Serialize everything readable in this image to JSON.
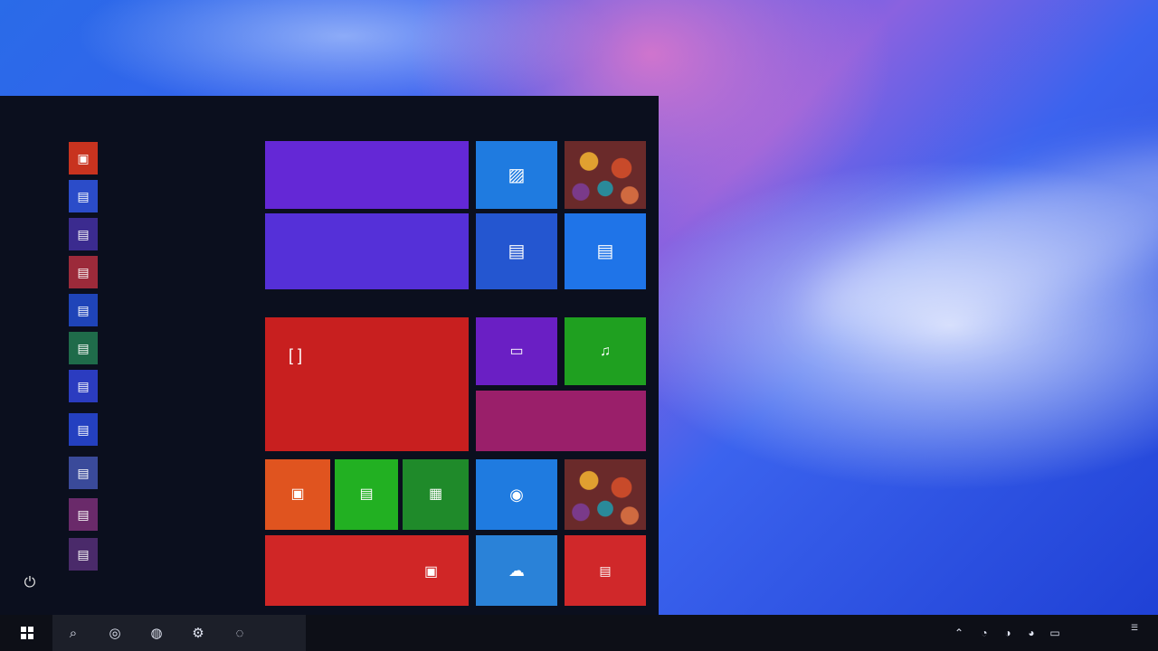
{
  "desktop": {
    "wallpaper": "blue-pink-gradient"
  },
  "start_menu": {
    "apps": [
      {
        "icon": "store-app-icon",
        "color": "#c8331f",
        "label": ""
      },
      {
        "icon": "document-app-icon",
        "color": "#2b4cc9",
        "label": ""
      },
      {
        "icon": "document-app-icon",
        "color": "#3b2b8f",
        "label": ""
      },
      {
        "icon": "document-app-icon",
        "color": "#9c2a3a",
        "label": ""
      },
      {
        "icon": "document-app-icon",
        "color": "#1f44b8",
        "label": ""
      },
      {
        "icon": "document-app-icon",
        "color": "#1f6b4a",
        "label": ""
      },
      {
        "icon": "document-app-icon",
        "color": "#2b3cc0",
        "label": ""
      },
      {
        "icon": "document-app-icon",
        "color": "#2440c0",
        "label": ""
      },
      {
        "icon": "document-app-icon",
        "color": "#3a4a9a",
        "label": ""
      },
      {
        "icon": "document-app-icon",
        "color": "#6a2a6a",
        "label": ""
      },
      {
        "icon": "document-app-icon",
        "color": "#4a2a6a",
        "label": ""
      },
      {
        "icon": "",
        "color": "",
        "label": ""
      }
    ],
    "power_icon": "power-icon"
  },
  "tiles": {
    "purple_wide_top": {
      "color": "#6428d6"
    },
    "purple_wide_text": {
      "color": "#5530d8",
      "text": "",
      "label": ""
    },
    "blue_photos": {
      "color": "#1f7be0",
      "icon": "photo-icon"
    },
    "mosaic_top": {
      "color": "#7a2e2e"
    },
    "blue_calendar": {
      "color": "#2456d0",
      "icon": "calendar-icon",
      "label": ""
    },
    "blue_mail": {
      "color": "#1f74e8",
      "icon": "mail-icon",
      "label": ""
    },
    "red_large": {
      "color": "#c81f1f",
      "icon": "frame-icon",
      "label": ""
    },
    "purple_small": {
      "color": "#6a1fc4",
      "icon": "mail-icon"
    },
    "green_small": {
      "color": "#1fa020",
      "icon": "game-icon",
      "label": ""
    },
    "magenta_wide": {
      "color": "#9a1f6a",
      "label": ""
    },
    "orange_small": {
      "color": "#e0541f",
      "icon": "office-icon"
    },
    "green_small2": {
      "color": "#22b022",
      "icon": "document-icon"
    },
    "green_xbox": {
      "color": "#1f8a2a",
      "icon": "xbox-icon"
    },
    "blue_skype": {
      "color": "#1f7be0",
      "icon": "skype-icon",
      "label": ""
    },
    "mosaic_bottom": {
      "color": "#8a3a5a"
    },
    "red_wide_bottom": {
      "color": "#d02626",
      "icon": "news-icon",
      "text": "",
      "label": ""
    },
    "blue_weather": {
      "color": "#2a82d8",
      "icon": "weather-icon",
      "label": ""
    },
    "red_small_bottom": {
      "color": "#d0282a",
      "icon": "news-icon"
    }
  },
  "taskbar": {
    "pinned": [
      {
        "icon": "search-icon"
      },
      {
        "icon": "cortana-icon"
      },
      {
        "icon": "edge-icon"
      },
      {
        "icon": "settings-icon"
      },
      {
        "icon": "store-icon"
      }
    ],
    "tray": [
      {
        "icon": "chevron-up-icon"
      },
      {
        "icon": "network-icon"
      },
      {
        "icon": "volume-icon"
      },
      {
        "icon": "battery-icon"
      },
      {
        "icon": "keyboard-icon"
      }
    ],
    "clock_time": "",
    "clock_date": ""
  }
}
